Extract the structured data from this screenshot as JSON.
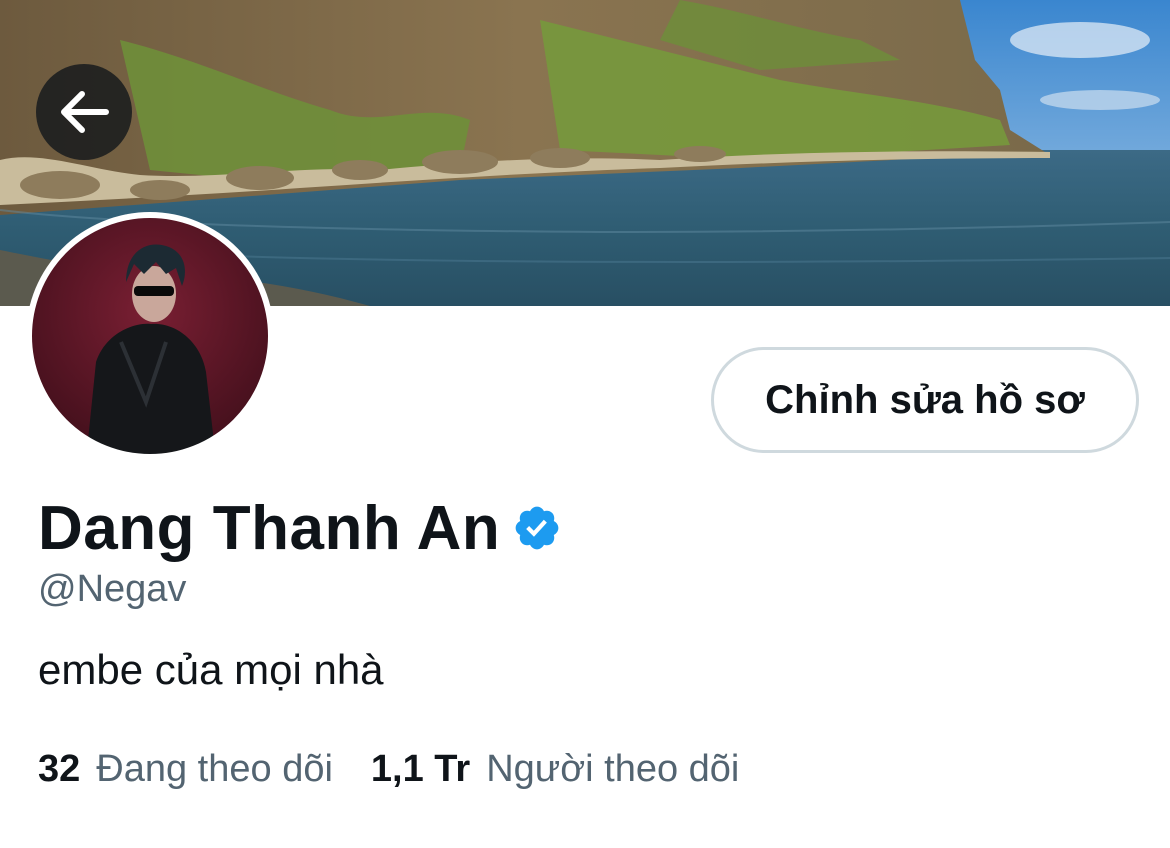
{
  "header": {
    "back_icon": "arrow-left-icon",
    "banner_description_icon": "banner-image"
  },
  "profile": {
    "display_name": "Dang Thanh An",
    "verified_icon": "verified-badge-icon",
    "handle": "@Negav",
    "bio": "embe của mọi nhà",
    "edit_button_label": "Chỉnh sửa hồ sơ"
  },
  "stats": {
    "following_count": "32",
    "following_label": "Đang theo dõi",
    "followers_count": "1,1 Tr",
    "followers_label": "Người theo dõi"
  },
  "colors": {
    "text_primary": "#0f1419",
    "text_secondary": "#536471",
    "verified_blue": "#1d9bf0",
    "button_border": "#cfd9de"
  }
}
